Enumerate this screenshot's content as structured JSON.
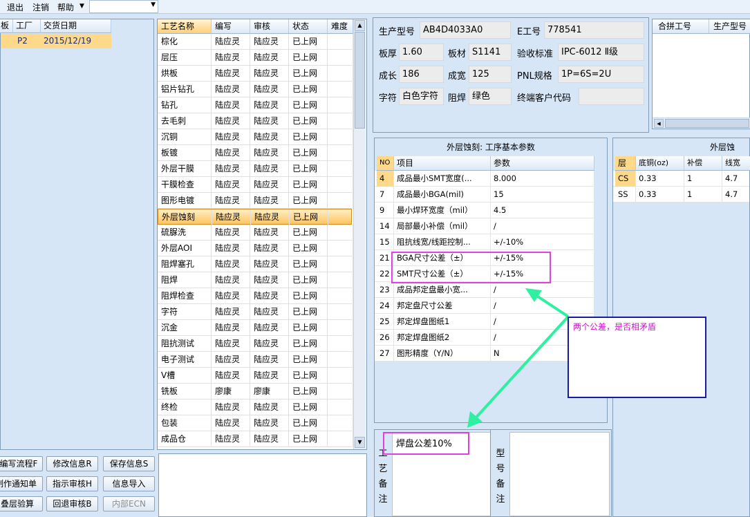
{
  "menu": {
    "exit": "退出",
    "logout": "注销",
    "help": "帮助"
  },
  "left_grid": {
    "headers": [
      "板",
      "工厂",
      "交货日期"
    ],
    "row": {
      "factory": "P2",
      "date": "2015/12/19"
    }
  },
  "process_grid": {
    "headers": [
      "工艺名称",
      "编写",
      "审核",
      "状态",
      "难度"
    ],
    "rows": [
      [
        "棕化",
        "陆应灵",
        "陆应灵",
        "已上网"
      ],
      [
        "层压",
        "陆应灵",
        "陆应灵",
        "已上网"
      ],
      [
        "烘板",
        "陆应灵",
        "陆应灵",
        "已上网"
      ],
      [
        "铝片钻孔",
        "陆应灵",
        "陆应灵",
        "已上网"
      ],
      [
        "钻孔",
        "陆应灵",
        "陆应灵",
        "已上网"
      ],
      [
        "去毛刺",
        "陆应灵",
        "陆应灵",
        "已上网"
      ],
      [
        "沉铜",
        "陆应灵",
        "陆应灵",
        "已上网"
      ],
      [
        "板镀",
        "陆应灵",
        "陆应灵",
        "已上网"
      ],
      [
        "外层干膜",
        "陆应灵",
        "陆应灵",
        "已上网"
      ],
      [
        "干膜检查",
        "陆应灵",
        "陆应灵",
        "已上网"
      ],
      [
        "图形电镀",
        "陆应灵",
        "陆应灵",
        "已上网"
      ],
      [
        "外层蚀刻",
        "陆应灵",
        "陆应灵",
        "已上网"
      ],
      [
        "硫脲洗",
        "陆应灵",
        "陆应灵",
        "已上网"
      ],
      [
        "外层AOI",
        "陆应灵",
        "陆应灵",
        "已上网"
      ],
      [
        "阻焊塞孔",
        "陆应灵",
        "陆应灵",
        "已上网"
      ],
      [
        "阻焊",
        "陆应灵",
        "陆应灵",
        "已上网"
      ],
      [
        "阻焊检查",
        "陆应灵",
        "陆应灵",
        "已上网"
      ],
      [
        "字符",
        "陆应灵",
        "陆应灵",
        "已上网"
      ],
      [
        "沉金",
        "陆应灵",
        "陆应灵",
        "已上网"
      ],
      [
        "阻抗测试",
        "陆应灵",
        "陆应灵",
        "已上网"
      ],
      [
        "电子测试",
        "陆应灵",
        "陆应灵",
        "已上网"
      ],
      [
        "V槽",
        "陆应灵",
        "陆应灵",
        "已上网"
      ],
      [
        "铣板",
        "廖康",
        "廖康",
        "已上网"
      ],
      [
        "终检",
        "陆应灵",
        "陆应灵",
        "已上网"
      ],
      [
        "包装",
        "陆应灵",
        "陆应灵",
        "已上网"
      ],
      [
        "成品仓",
        "陆应灵",
        "陆应灵",
        "已上网"
      ]
    ],
    "selected_index": 11
  },
  "buttons": {
    "edit_flow": "编写流程F",
    "modify_info": "修改信息R",
    "save_info": "保存信息S",
    "work_notice": "制作通知单",
    "assign_review": "指示审核H",
    "import_info": "信息导入",
    "layer_check": "叠层验算",
    "return_review": "回退审核B",
    "internal_ecn": "内部ECN"
  },
  "info": {
    "model_label": "生产型号",
    "model_value": "AB4D4033A0",
    "eno_label": "E工号",
    "eno_value": "778541",
    "thickness_label": "板厚",
    "thickness_value": "1.60",
    "material_label": "板材",
    "material_value": "S1141",
    "standard_label": "验收标准",
    "standard_value": "IPC-6012 Ⅱ级",
    "length_label": "成长",
    "length_value": "186",
    "width_label": "成宽",
    "width_value": "125",
    "pnl_label": "PNL规格",
    "pnl_value": "1P=6S=2U",
    "char_label": "字符",
    "char_value": "白色字符",
    "mask_label": "阻焊",
    "mask_value": "绿色",
    "customer_label": "终端客户代码",
    "customer_value": ""
  },
  "hebing": {
    "headers": [
      "合拼工号",
      "生产型号"
    ]
  },
  "param_panel": {
    "title": "外层蚀刻: 工序基本参数",
    "headers": [
      "NO",
      "项目",
      "参数"
    ],
    "rows": [
      [
        "4",
        "成品最小SMT宽度(...",
        "8.000"
      ],
      [
        "7",
        "成品最小BGA(mil)",
        "15"
      ],
      [
        "9",
        "最小焊环宽度（mil）",
        "4.5"
      ],
      [
        "14",
        "局部最小补偿（mil）",
        "/"
      ],
      [
        "15",
        "阻抗线宽/线距控制...",
        "+/-10%"
      ],
      [
        "21",
        "BGA尺寸公差（±）",
        "+/-15%"
      ],
      [
        "22",
        "SMT尺寸公差（±）",
        "+/-15%"
      ],
      [
        "23",
        "成品邦定盘最小宽...",
        "/"
      ],
      [
        "24",
        "邦定盘尺寸公差",
        "/"
      ],
      [
        "25",
        "邦定焊盘图纸1",
        "/"
      ],
      [
        "26",
        "邦定焊盘图纸2",
        "/"
      ],
      [
        "27",
        "图形精度（Y/N）",
        "N"
      ]
    ]
  },
  "outer_panel": {
    "title": "外层蚀",
    "headers": [
      "层",
      "底铜(oz)",
      "补偿",
      "线宽"
    ],
    "rows": [
      [
        "CS",
        "0.33",
        "1",
        "4.7"
      ],
      [
        "SS",
        "0.33",
        "1",
        "4.7"
      ]
    ]
  },
  "memo": {
    "gongyi_label": "工艺备注",
    "gongyi_text": "焊盘公差10%",
    "xinghao_label": "型号备注"
  },
  "annotation": {
    "note": "两个公差，是否相矛盾"
  }
}
